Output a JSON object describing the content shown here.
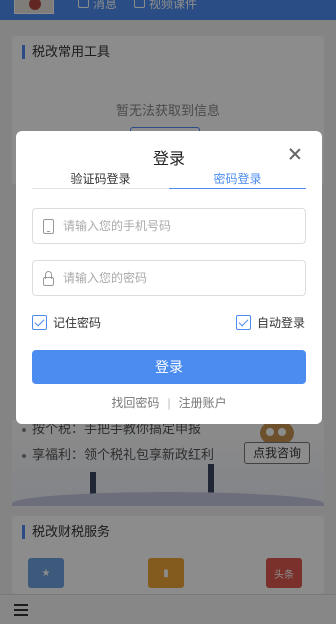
{
  "topbar": {
    "messages_label": "消息",
    "videos_label": "视频课件"
  },
  "tools_section": {
    "title": "税改常用工具",
    "empty_text": "暂无法获取到信息"
  },
  "banner": {
    "line1": "按个税：手把手教你搞定申报",
    "line2": "享福利：领个税礼包享新政红利",
    "ask_button": "点我咨询"
  },
  "services_section": {
    "title": "税改财税服务",
    "icon3_text": "头条"
  },
  "login_modal": {
    "title": "登录",
    "tabs": [
      {
        "label": "验证码登录",
        "active": false
      },
      {
        "label": "密码登录",
        "active": true
      }
    ],
    "phone_placeholder": "请输入您的手机号码",
    "password_placeholder": "请输入您的密码",
    "remember_password": {
      "label": "记住密码",
      "checked": true
    },
    "auto_login": {
      "label": "自动登录",
      "checked": true
    },
    "submit_label": "登录",
    "forgot_password": "找回密码",
    "separator": "|",
    "register": "注册账户"
  },
  "colors": {
    "accent": "#4b8cf0",
    "overlay": "rgba(0,0,0,0.45)"
  }
}
